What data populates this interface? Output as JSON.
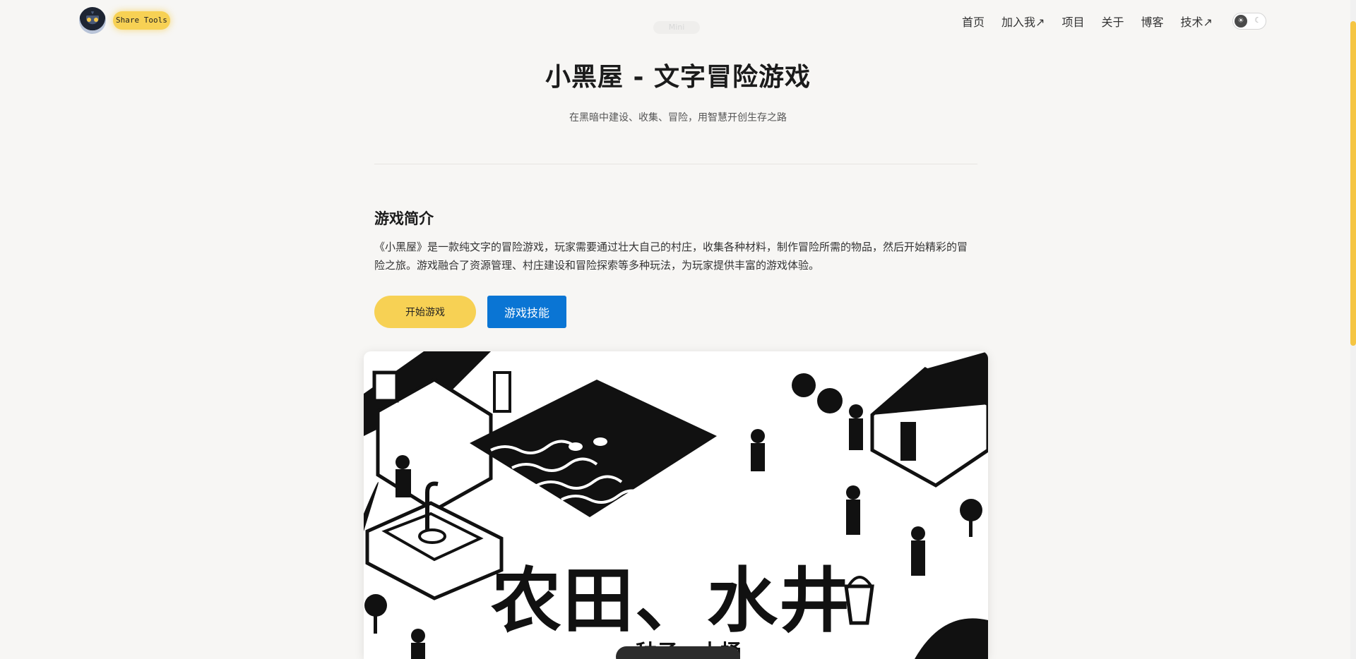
{
  "header": {
    "brand": "Share Tools",
    "nav": [
      "首页",
      "加入我↗",
      "项目",
      "关于",
      "博客",
      "技术↗"
    ],
    "ghost_tab": "Mini"
  },
  "hero": {
    "title": "小黑屋 - 文字冒险游戏",
    "subtitle": "在黑暗中建设、收集、冒险，用智慧开创生存之路"
  },
  "intro": {
    "heading": "游戏简介",
    "text": "《小黑屋》是一款纯文字的冒险游戏，玩家需要通过壮大自己的村庄，收集各种材料，制作冒险所需的物品，然后开始精彩的冒险之旅。游戏融合了资源管理、村庄建设和冒险探索等多种玩法，为玩家提供丰富的游戏体验。"
  },
  "buttons": {
    "start": "开始游戏",
    "skills": "游戏技能"
  },
  "illustration": {
    "caption": "农田、水井",
    "sub_caption": "种子、木桶"
  },
  "colors": {
    "accent_yellow": "#f7d154",
    "accent_blue": "#0a75d4",
    "background": "#f7f6f4"
  },
  "icons": {
    "theme_light": "sun-icon",
    "theme_dark": "moon-icon"
  }
}
